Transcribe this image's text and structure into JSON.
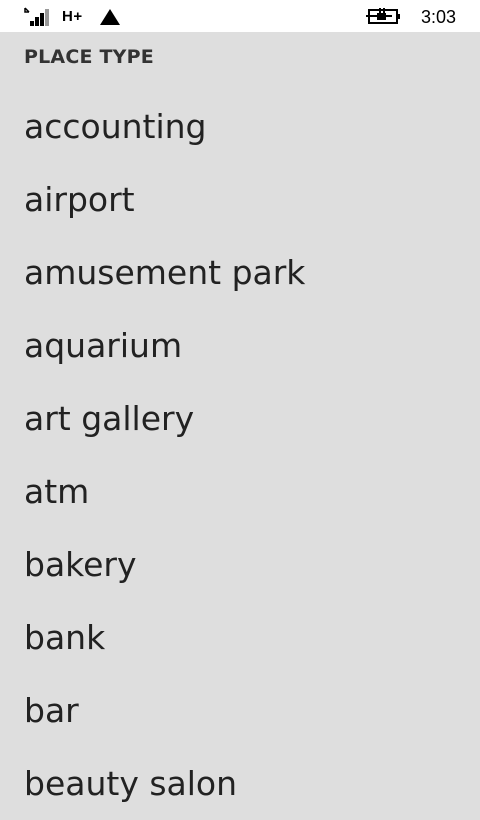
{
  "status_bar": {
    "network": "H+",
    "time": "3:03",
    "icons": [
      "signal-icon",
      "data-transfer-icon",
      "battery-charging-icon"
    ]
  },
  "header": {
    "title": "PLACE TYPE"
  },
  "place_types": [
    "accounting",
    "airport",
    "amusement park",
    "aquarium",
    "art gallery",
    "atm",
    "bakery",
    "bank",
    "bar",
    "beauty salon"
  ]
}
